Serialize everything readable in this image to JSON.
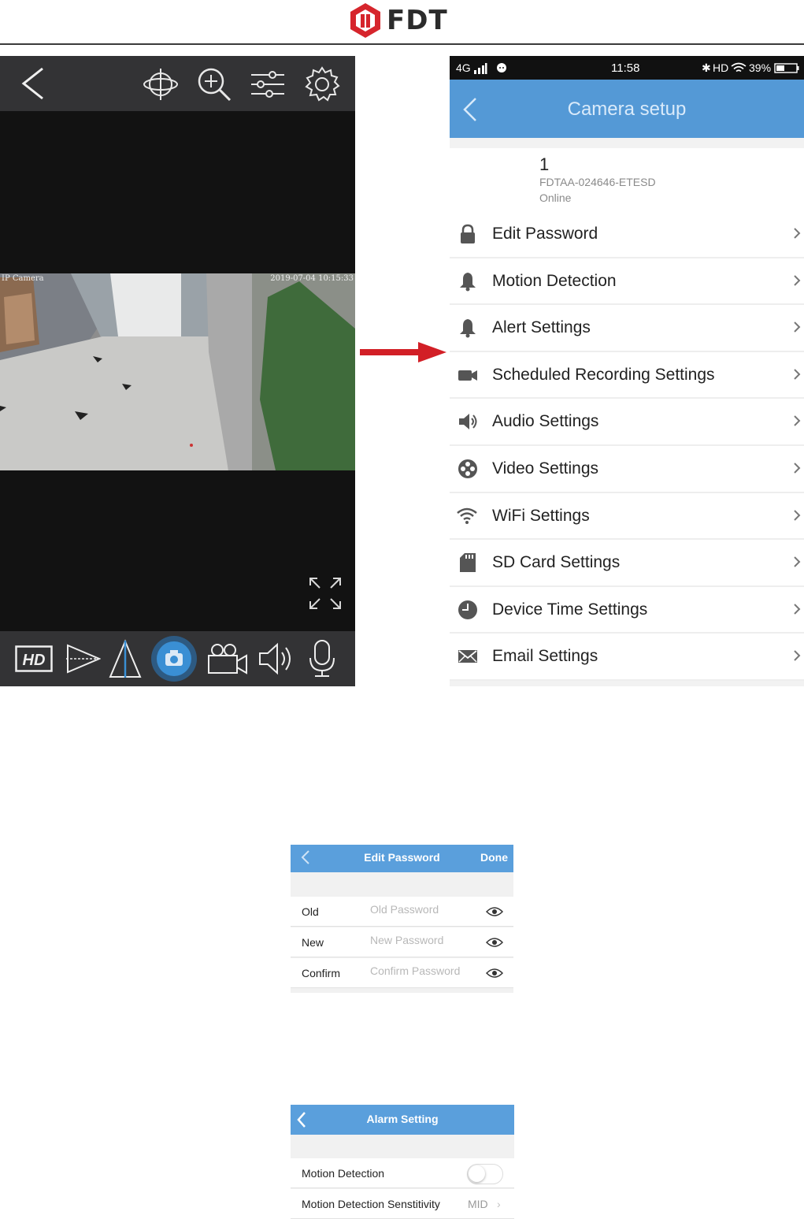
{
  "logo": {
    "text": "FDT",
    "brand_color": "#d6252c"
  },
  "camera_view": {
    "top_icons": [
      "back-icon",
      "ptz-rotate-icon",
      "zoom-in-icon",
      "adjust-sliders-icon",
      "settings-gear-icon"
    ],
    "overlay_label": "IP Camera",
    "overlay_timestamp": "2019-07-04 10:15:33",
    "bottom_icons": [
      "hd-icon",
      "flip-horizontal-icon",
      "flip-vertical-icon",
      "snapshot-camera-icon",
      "record-video-icon",
      "speaker-icon",
      "microphone-icon"
    ],
    "hd_label": "HD",
    "snapshot_active_color": "#3a8fd4"
  },
  "phone": {
    "status": {
      "network": "4G",
      "time": "11:58",
      "hd": "HD",
      "battery": "39%"
    },
    "nav_title": "Camera setup",
    "device": {
      "name": "1",
      "id": "FDTAA-024646-ETESD",
      "state": "Online"
    },
    "settings": [
      {
        "label": "Edit Password",
        "icon": "lock-icon"
      },
      {
        "label": "Motion Detection",
        "icon": "bell-icon"
      },
      {
        "label": "Alert Settings",
        "icon": "bell-icon"
      },
      {
        "label": "Scheduled Recording Settings",
        "icon": "video-camera-icon"
      },
      {
        "label": "Audio Settings",
        "icon": "speaker-icon"
      },
      {
        "label": "Video Settings",
        "icon": "film-reel-icon"
      },
      {
        "label": "WiFi Settings",
        "icon": "wifi-icon"
      },
      {
        "label": "SD Card Settings",
        "icon": "sd-card-icon"
      },
      {
        "label": "Device Time Settings",
        "icon": "clock-icon"
      },
      {
        "label": "Email Settings",
        "icon": "envelope-icon"
      }
    ],
    "accent_color": "#5499d6"
  },
  "edit_password": {
    "title": "Edit Password",
    "done_label": "Done",
    "rows": [
      {
        "label": "Old",
        "placeholder": "Old Password"
      },
      {
        "label": "New",
        "placeholder": "New Password"
      },
      {
        "label": "Confirm",
        "placeholder": "Confirm Password"
      }
    ]
  },
  "alarm_setting": {
    "title": "Alarm Setting",
    "motion_detection_label": "Motion Detection",
    "motion_detection_enabled": false,
    "sensitivity_label": "Motion Detection Senstitivity",
    "sensitivity_value": "MID"
  }
}
